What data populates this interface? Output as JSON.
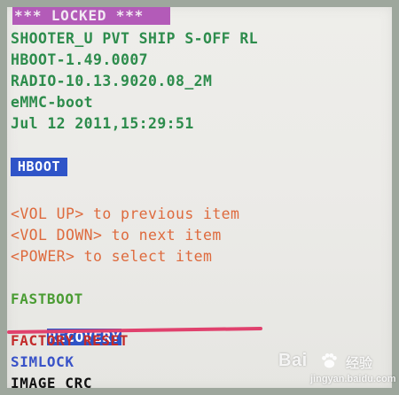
{
  "status": {
    "label": "*** LOCKED ***"
  },
  "device_info": [
    {
      "text": "SHOOTER_U PVT SHIP S-OFF RL"
    },
    {
      "text": "HBOOT-1.49.0007"
    },
    {
      "text": "RADIO-10.13.9020.08_2M"
    },
    {
      "text": "eMMC-boot"
    },
    {
      "text": "Jul 12 2011,15:29:51"
    }
  ],
  "menu_title": "HBOOT",
  "instructions": [
    "<VOL UP> to previous item",
    "<VOL DOWN> to next item",
    "<POWER> to select item"
  ],
  "menu_items": [
    {
      "label": "FASTBOOT",
      "color": "#4a9c33"
    },
    {
      "label": "RECOVERY",
      "color": "#ffffff"
    },
    {
      "label": "FACTORY RESET",
      "color": "#c32b2b"
    },
    {
      "label": "SIMLOCK",
      "color": "#3852c8"
    },
    {
      "label": "IMAGE CRC",
      "color": "#111111"
    }
  ],
  "colors": {
    "status_bg": "#b35bb8",
    "info_text": "#2d8c4c",
    "instruction_text": "#de6a3d",
    "selected_bg": "#2f54c8",
    "highlight_underline": "#e0416d"
  },
  "watermark": {
    "brand": "Bai",
    "sub": "经验",
    "url": "jingyan.baidu.com"
  }
}
